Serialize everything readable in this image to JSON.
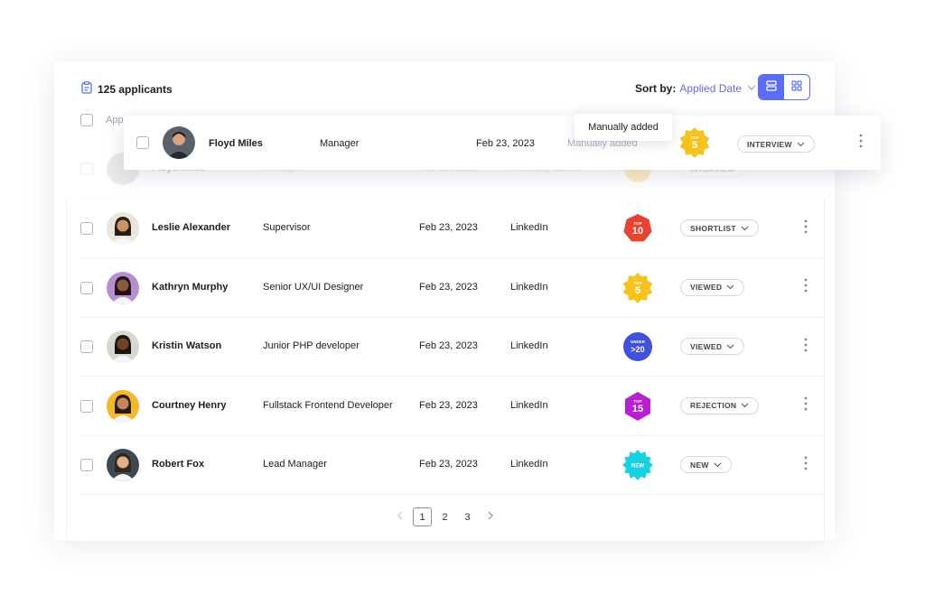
{
  "header": {
    "count_label": "125 applicants",
    "sort_label": "Sort by:",
    "sort_value": "Applied Date",
    "column_applicant": "App"
  },
  "tooltip": {
    "text": "Manually added"
  },
  "floating_row": {
    "name": "Floyd Miles",
    "role": "Manager",
    "date": "Feb 23, 2023",
    "source": "Manually added",
    "badge": {
      "top": "TOP",
      "num": "5",
      "color": "#f6c21c",
      "shape": "starburst"
    },
    "status": "INTERVIEW"
  },
  "ghost_row": {
    "name": "Floyd Miles",
    "role": "Manager",
    "date": "Feb 23, 2023",
    "source": "Manually added",
    "status": "INTERVIEW"
  },
  "rows": [
    {
      "name": "Leslie Alexander",
      "role": "Supervisor",
      "date": "Feb 23, 2023",
      "source": "LinkedIn",
      "badge": {
        "top": "TOP",
        "num": "10",
        "color": "#e8432e",
        "shape": "heptagon"
      },
      "status": "SHORTLIST",
      "avatar_bg": "#e9e4dc",
      "skin": "#c9956b",
      "hair": "#2b1d14"
    },
    {
      "name": "Kathryn Murphy",
      "role": "Senior UX/UI Designer",
      "date": "Feb 23, 2023",
      "source": "LinkedIn",
      "badge": {
        "top": "TOP",
        "num": "5",
        "color": "#f6c21c",
        "shape": "starburst"
      },
      "status": "VIEWED",
      "avatar_bg": "#b48fd4",
      "skin": "#8a5a3c",
      "hair": "#1f1410"
    },
    {
      "name": "Kristin Watson",
      "role": "Junior PHP developer",
      "date": "Feb 23, 2023",
      "source": "LinkedIn",
      "badge": {
        "top": "UNDER",
        "num": ">20",
        "color": "#3f51d9",
        "shape": "circle"
      },
      "status": "VIEWED",
      "avatar_bg": "#d8d6d0",
      "skin": "#6e4428",
      "hair": "#1a120c"
    },
    {
      "name": "Courtney Henry",
      "role": "Fullstack Frontend Developer",
      "date": "Feb 23, 2023",
      "source": "LinkedIn",
      "badge": {
        "top": "TOP",
        "num": "15",
        "color": "#b81fd1",
        "shape": "hexagon"
      },
      "status": "REJECTION",
      "avatar_bg": "#f2b92c",
      "skin": "#c48660",
      "hair": "#2c1a10"
    },
    {
      "name": "Robert Fox",
      "role": "Lead Manager",
      "date": "Feb 23, 2023",
      "source": "LinkedIn",
      "badge": {
        "top": "",
        "num": "NEW",
        "color": "#18d1e0",
        "shape": "burst"
      },
      "status": "NEW",
      "avatar_bg": "#3c4a56",
      "skin": "#e0b08c",
      "hair": "#3a2614"
    }
  ],
  "pagination": {
    "pages": [
      "1",
      "2",
      "3"
    ],
    "current": "1"
  }
}
